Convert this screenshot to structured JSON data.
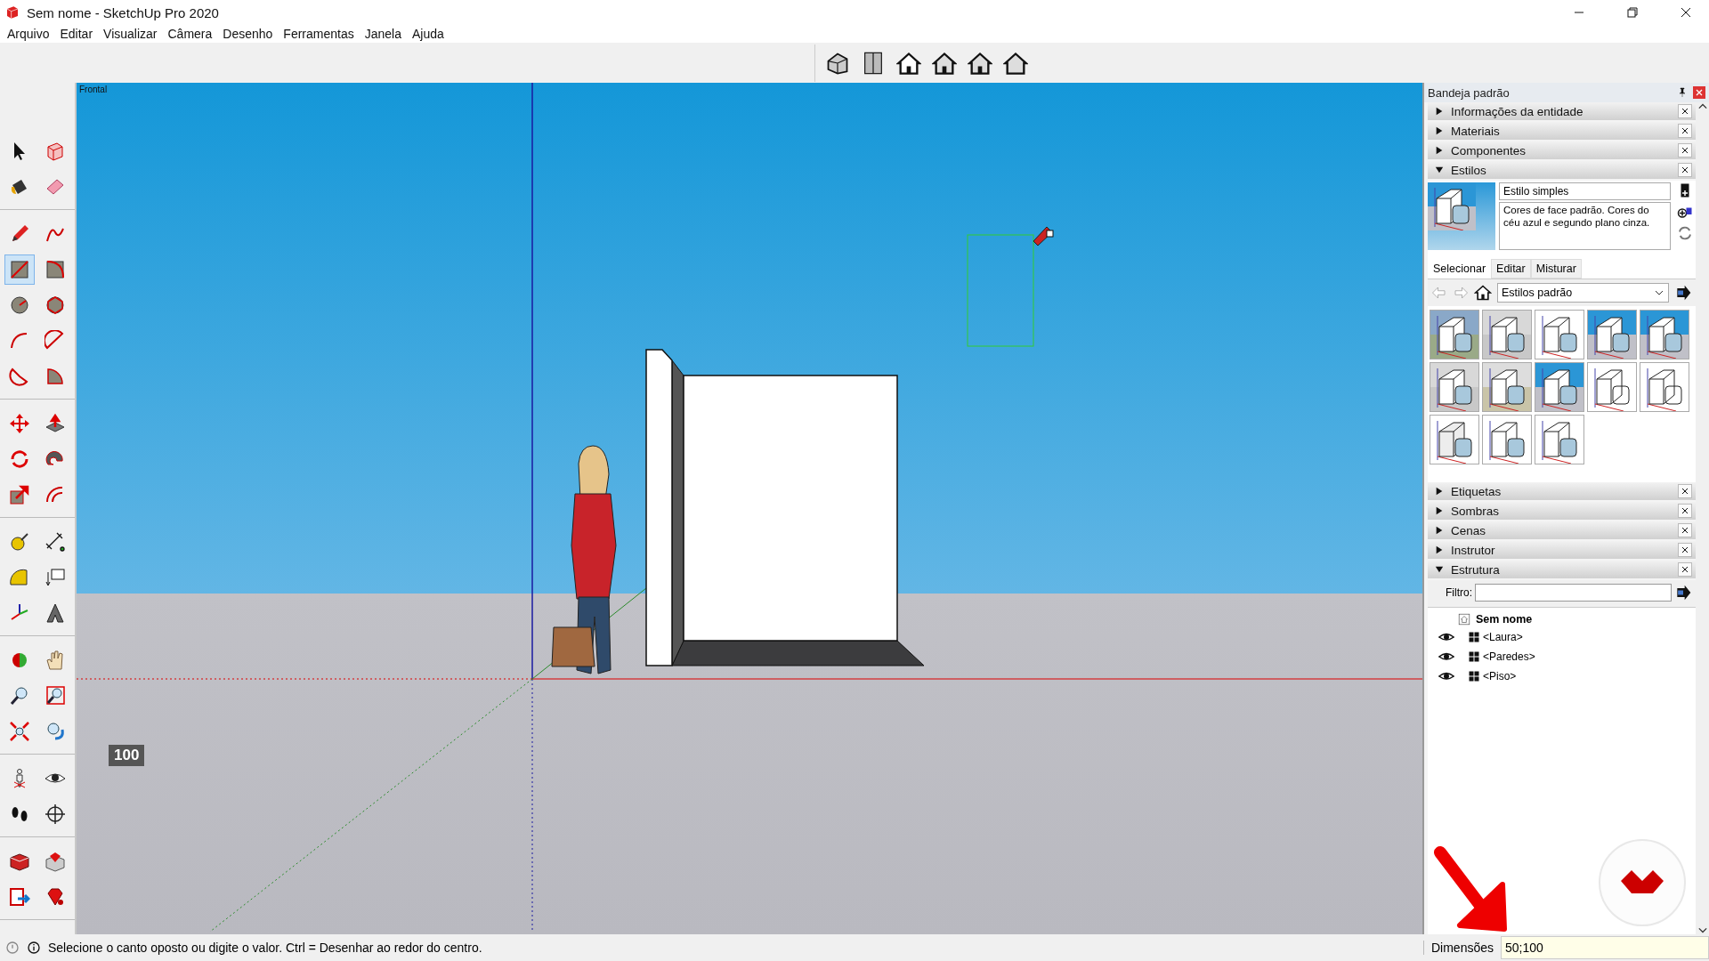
{
  "window": {
    "title": "Sem nome - SketchUp Pro 2020"
  },
  "menu": [
    "Arquivo",
    "Editar",
    "Visualizar",
    "Câmera",
    "Desenho",
    "Ferramentas",
    "Janela",
    "Ajuda"
  ],
  "tool_groups": [
    [
      {
        "kind": "select",
        "selected": false
      },
      {
        "kind": "component",
        "selected": false
      },
      {
        "kind": "paint",
        "selected": false
      },
      {
        "kind": "eraser",
        "selected": false
      }
    ],
    [
      {
        "kind": "pencil",
        "selected": false
      },
      {
        "kind": "freehand",
        "selected": false
      },
      {
        "kind": "rectangle",
        "selected": true
      },
      {
        "kind": "rotated_rectangle",
        "selected": false
      },
      {
        "kind": "circle",
        "selected": false
      },
      {
        "kind": "polygon",
        "selected": false
      },
      {
        "kind": "arc",
        "selected": false
      },
      {
        "kind": "arc2",
        "selected": false
      },
      {
        "kind": "arc3",
        "selected": false
      },
      {
        "kind": "pie",
        "selected": false
      }
    ],
    [
      {
        "kind": "move",
        "selected": false
      },
      {
        "kind": "pushpull",
        "selected": false
      },
      {
        "kind": "rotate",
        "selected": false
      },
      {
        "kind": "followme",
        "selected": false
      },
      {
        "kind": "scale",
        "selected": false
      },
      {
        "kind": "offset",
        "selected": false
      }
    ],
    [
      {
        "kind": "tape",
        "selected": false
      },
      {
        "kind": "dimension",
        "selected": false
      },
      {
        "kind": "protractor",
        "selected": false
      },
      {
        "kind": "label",
        "selected": false
      },
      {
        "kind": "axes",
        "selected": false
      },
      {
        "kind": "text3d",
        "selected": false
      }
    ],
    [
      {
        "kind": "orbit",
        "selected": false
      },
      {
        "kind": "pan",
        "selected": false
      },
      {
        "kind": "zoom",
        "selected": false
      },
      {
        "kind": "zoomwindow",
        "selected": false
      },
      {
        "kind": "zoomextents",
        "selected": false
      },
      {
        "kind": "previous",
        "selected": false
      }
    ],
    [
      {
        "kind": "position",
        "selected": false
      },
      {
        "kind": "lookaround",
        "selected": false
      },
      {
        "kind": "walk",
        "selected": false
      },
      {
        "kind": "section",
        "selected": false
      }
    ],
    [
      {
        "kind": "warehouse",
        "selected": false
      },
      {
        "kind": "extwarehouse",
        "selected": false
      },
      {
        "kind": "layout",
        "selected": false
      },
      {
        "kind": "extmanager",
        "selected": false
      }
    ]
  ],
  "viewport": {
    "scene_label": "Frontal",
    "badge": "100"
  },
  "tray": {
    "title": "Bandeja padrão",
    "panels": [
      {
        "label": "Informações da entidade",
        "expanded": false
      },
      {
        "label": "Materiais",
        "expanded": false
      },
      {
        "label": "Componentes",
        "expanded": false
      },
      {
        "label": "Estilos",
        "expanded": true,
        "kind": "styles",
        "style_name": "Estilo simples",
        "description": "Cores de face padrão. Cores do céu azul e segundo plano cinza.",
        "tabs": [
          {
            "label": "Selecionar",
            "selected": true
          },
          {
            "label": "Editar",
            "selected": false
          },
          {
            "label": "Misturar",
            "selected": false
          }
        ],
        "collection": "Estilos padrão",
        "thumbnails": [
          {
            "kind": "green"
          },
          {
            "kind": "plain"
          },
          {
            "kind": "white"
          },
          {
            "kind": "sky"
          },
          {
            "kind": "sky"
          },
          {
            "kind": "plain"
          },
          {
            "kind": "tan"
          },
          {
            "kind": "sky"
          },
          {
            "kind": "wire"
          },
          {
            "kind": "wire"
          },
          {
            "kind": "xray"
          },
          {
            "kind": "white"
          },
          {
            "kind": "white"
          }
        ]
      },
      {
        "label": "Etiquetas",
        "expanded": false
      },
      {
        "label": "Sombras",
        "expanded": false
      },
      {
        "label": "Cenas",
        "expanded": false
      },
      {
        "label": "Instrutor",
        "expanded": false
      },
      {
        "label": "Estrutura",
        "expanded": true,
        "kind": "outliner",
        "filter_label": "Filtro:",
        "root": "Sem nome",
        "children": [
          {
            "label": "<Laura>",
            "visible": true
          },
          {
            "label": "<Paredes>",
            "visible": true
          },
          {
            "label": "<Piso>",
            "visible": true
          }
        ]
      }
    ]
  },
  "status_bar": {
    "message": "Selecione o canto oposto ou digite o valor. Ctrl = Desenhar ao redor do centro.",
    "measure_label": "Dimensões",
    "measure_value": "50;100"
  }
}
